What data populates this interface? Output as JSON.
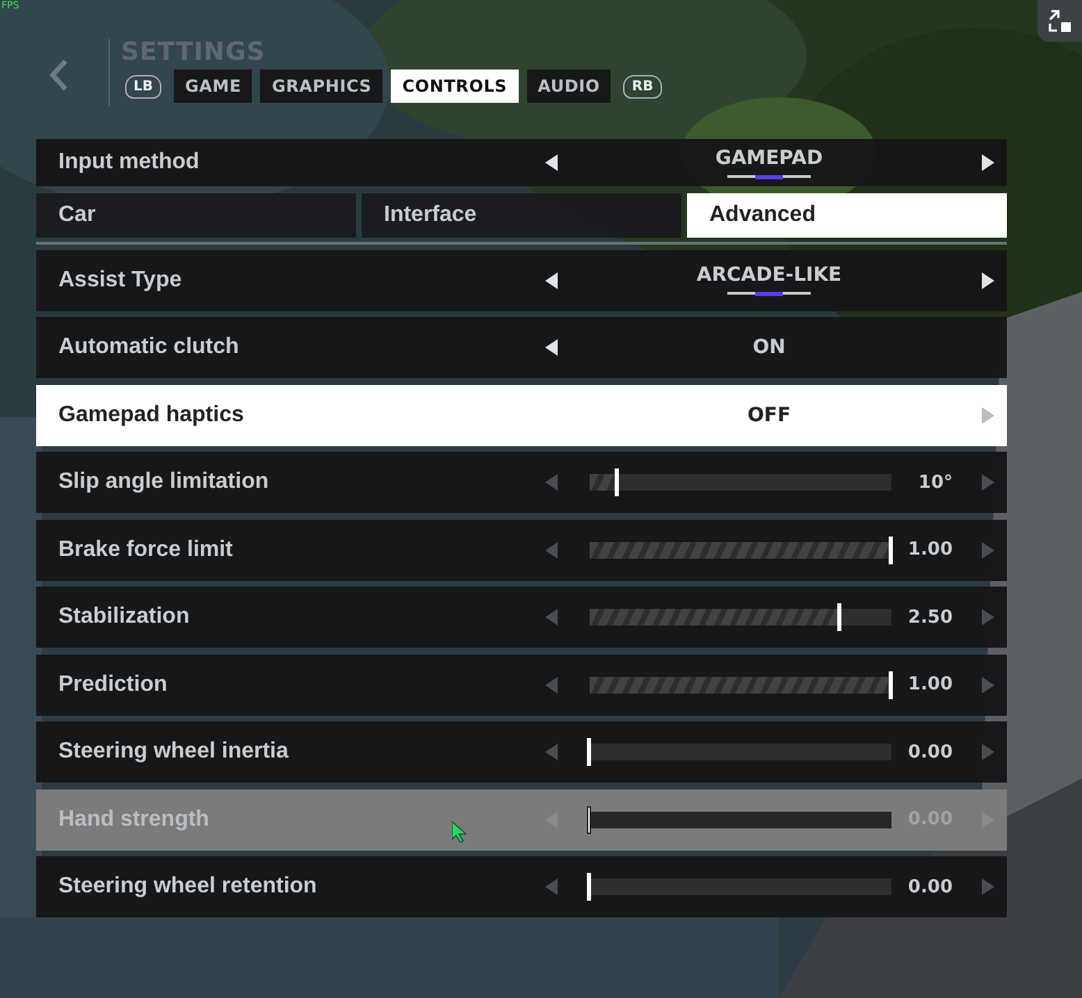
{
  "fps_label": "FPS",
  "header": {
    "title": "SETTINGS",
    "prev_hint": "LB",
    "next_hint": "RB"
  },
  "tabs": [
    {
      "label": "GAME",
      "selected": false
    },
    {
      "label": "GRAPHICS",
      "selected": false
    },
    {
      "label": "CONTROLS",
      "selected": true
    },
    {
      "label": "AUDIO",
      "selected": false
    }
  ],
  "input_method": {
    "kind": "selector",
    "label": "Input method",
    "value": "GAMEPAD",
    "selected": false,
    "hovered": false,
    "can_decrease": true,
    "can_increase": true,
    "options": [
      {
        "selected": false
      },
      {
        "selected": true
      },
      {
        "selected": false
      }
    ]
  },
  "subtabs": [
    {
      "label": "Car",
      "selected": false
    },
    {
      "label": "Interface",
      "selected": false
    },
    {
      "label": "Advanced",
      "selected": true
    }
  ],
  "rows": [
    {
      "kind": "selector",
      "label": "Assist Type",
      "value": "ARCADE-LIKE",
      "selected": false,
      "hovered": false,
      "can_decrease": true,
      "can_increase": true,
      "options": [
        {
          "selected": false
        },
        {
          "selected": true
        },
        {
          "selected": false
        }
      ]
    },
    {
      "kind": "selector",
      "label": "Automatic clutch",
      "value": "ON",
      "selected": false,
      "hovered": false,
      "can_decrease": true,
      "can_increase": false
    },
    {
      "kind": "selector",
      "label": "Gamepad haptics",
      "value": "OFF",
      "selected": true,
      "hovered": false,
      "can_decrease": false,
      "can_increase": true
    },
    {
      "kind": "slider",
      "label": "Slip angle limitation",
      "value": "10°",
      "level": 0.09,
      "selected": false,
      "hovered": false
    },
    {
      "kind": "slider",
      "label": "Brake force limit",
      "value": "1.00",
      "level": 1,
      "selected": false,
      "hovered": false
    },
    {
      "kind": "slider",
      "label": "Stabilization",
      "value": "2.50",
      "level": 0.83,
      "selected": false,
      "hovered": false
    },
    {
      "kind": "slider",
      "label": "Prediction",
      "value": "1.00",
      "level": 1,
      "selected": false,
      "hovered": false
    },
    {
      "kind": "slider",
      "label": "Steering wheel inertia",
      "value": "0.00",
      "level": 0,
      "selected": false,
      "hovered": false
    },
    {
      "kind": "slider",
      "label": "Hand strength",
      "value": "0.00",
      "level": 0,
      "selected": false,
      "hovered": true
    },
    {
      "kind": "slider",
      "label": "Steering wheel retention",
      "value": "0.00",
      "level": 0,
      "selected": false,
      "hovered": false
    }
  ]
}
